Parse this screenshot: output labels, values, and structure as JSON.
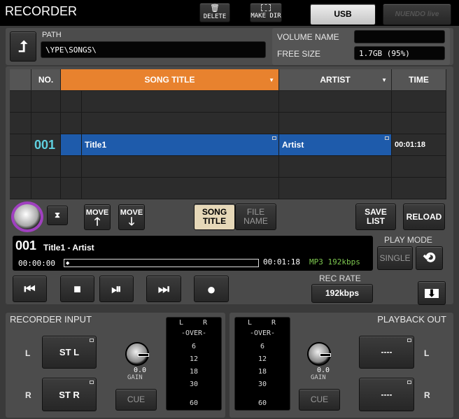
{
  "title": "RECORDER",
  "toolbar": {
    "delete": "DELETE",
    "make_dir": "MAKE DIR",
    "usb": "USB",
    "nuendo": "NUENDO live"
  },
  "path": {
    "label": "PATH",
    "value": "\\YPE\\SONGS\\"
  },
  "volume": {
    "name_label": "VOLUME NAME",
    "name_value": "",
    "free_label": "FREE SIZE",
    "free_value": "1.7GB (95%)"
  },
  "table": {
    "headers": {
      "no": "NO.",
      "title": "SONG TITLE",
      "artist": "ARTIST",
      "time": "TIME"
    },
    "rows": [
      {
        "no": "",
        "title": "",
        "artist": "",
        "time": ""
      },
      {
        "no": "",
        "title": "",
        "artist": "",
        "time": ""
      },
      {
        "no": "001",
        "title": "Title1",
        "artist": "Artist",
        "time": "00:01:18",
        "selected": true
      },
      {
        "no": "",
        "title": "",
        "artist": "",
        "time": ""
      },
      {
        "no": "",
        "title": "",
        "artist": "",
        "time": ""
      }
    ]
  },
  "controls": {
    "move_up": "MOVE",
    "move_down": "MOVE",
    "song_title": "SONG TITLE",
    "file_name": "FILE NAME",
    "save_list": "SAVE LIST",
    "reload": "RELOAD"
  },
  "display": {
    "number": "001",
    "song": "Title1 - Artist",
    "elapsed": "00:00:00",
    "total": "00:01:18",
    "format": "MP3 192kbps",
    "progress": 0
  },
  "play_mode": {
    "label": "PLAY MODE",
    "single": "SINGLE"
  },
  "rec_rate": {
    "label": "REC RATE",
    "value": "192kbps"
  },
  "recorder_input": {
    "title": "RECORDER INPUT",
    "l_label": "L",
    "r_label": "R",
    "l_value": "ST L",
    "r_value": "ST R",
    "gain_value": "0.0",
    "gain_label": "GAIN",
    "cue": "CUE"
  },
  "playback_out": {
    "title": "PLAYBACK OUT",
    "l_label": "L",
    "r_label": "R",
    "l_value": "----",
    "r_value": "----",
    "gain_value": "0.0",
    "gain_label": "GAIN",
    "cue": "CUE"
  },
  "meter": {
    "l": "L",
    "r": "R",
    "scale": [
      "-OVER-",
      "6",
      "12",
      "18",
      "30",
      "60"
    ]
  },
  "colors": {
    "accent_orange": "#e8822e",
    "selected_blue": "#1e5bab",
    "number_cyan": "#5fd0e0",
    "format_green": "#7ec850",
    "knob_ring": "#a040c0"
  }
}
